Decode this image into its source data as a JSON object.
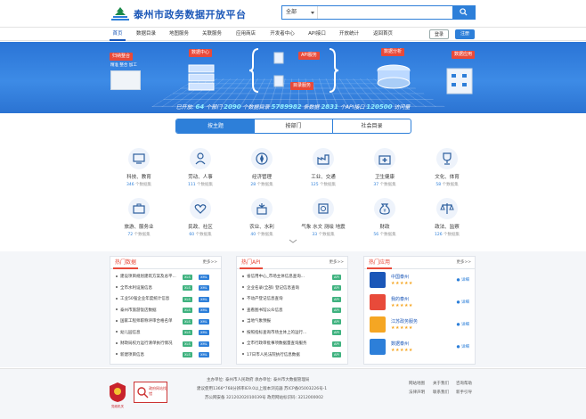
{
  "header": {
    "brand": "泰州市政务数据开放平台"
  },
  "search": {
    "scope": "全部",
    "placeholder": ""
  },
  "nav": {
    "items": [
      "首页",
      "数据目录",
      "地图服务",
      "关联服务",
      "应用商店",
      "开发者中心",
      "API接口",
      "开放统计",
      "返回首页"
    ],
    "login": "登录",
    "register": "注册"
  },
  "banner": {
    "tags": [
      "归纳整合",
      "数据中心",
      "数据分析",
      "数据应用",
      "API服务",
      "目录服务"
    ],
    "sub": "精准 整合 加工",
    "stats": {
      "prefix": "已开放:",
      "departments": "64",
      "dept_label": "个部门",
      "catalogs": "2090",
      "cat_label": "个数据目录",
      "records": "5789982",
      "rec_label": "条数据",
      "apis": "2831",
      "api_label": "个API接口",
      "visits": "120500",
      "visit_label": "访问量"
    }
  },
  "tabs": [
    "按主题",
    "按部门",
    "社会目录"
  ],
  "categories": [
    {
      "label": "科技、教育",
      "count": "346",
      "unit": "个数据集"
    },
    {
      "label": "劳动、人事",
      "count": "111",
      "unit": "个数据集"
    },
    {
      "label": "经济管理",
      "count": "28",
      "unit": "个数据集"
    },
    {
      "label": "工业、交通",
      "count": "125",
      "unit": "个数据集"
    },
    {
      "label": "卫生健康",
      "count": "37",
      "unit": "个数据集"
    },
    {
      "label": "文化、体育",
      "count": "58",
      "unit": "个数据集"
    },
    {
      "label": "旅游、服务业",
      "count": "72",
      "unit": "个数据集"
    },
    {
      "label": "民政、社区",
      "count": "60",
      "unit": "个数据集"
    },
    {
      "label": "农业、水利",
      "count": "40",
      "unit": "个数据集"
    },
    {
      "label": "气象 水文 测绘 地震",
      "count": "33",
      "unit": "个数据集"
    },
    {
      "label": "财政",
      "count": "56",
      "unit": "个数据集"
    },
    {
      "label": "政法、监察",
      "count": "126",
      "unit": "个数据集"
    }
  ],
  "hot_data": {
    "title": "热门数据",
    "more": "更多>>",
    "rows": [
      {
        "text": "建设项目规划建筑方案及总平...",
        "badges": [
          "XLS",
          "XML"
        ]
      },
      {
        "text": "全市水利设施信息",
        "badges": [
          "XLS",
          "XML"
        ]
      },
      {
        "text": "工业50强企业年度统计信息",
        "badges": [
          "XLS",
          "XML"
        ]
      },
      {
        "text": "泰州市旅游饭店数据",
        "badges": [
          "XLS",
          "XML"
        ]
      },
      {
        "text": "国家工程师职称评审合格名单",
        "badges": [
          "XLS",
          "XML"
        ]
      },
      {
        "text": "幼儿园信息",
        "badges": [
          "XLS",
          "XML"
        ]
      },
      {
        "text": "财政局权力运行清单执行情况",
        "badges": [
          "XLS",
          "XML"
        ]
      },
      {
        "text": "新建项目信息",
        "badges": [
          "XLS",
          "XML"
        ]
      }
    ]
  },
  "hot_api": {
    "title": "热门API",
    "more": "更多>>",
    "rows": [
      {
        "text": "省信用中心_市场主体信息查询...",
        "badge": "API"
      },
      {
        "text": "企业名录(全部) 登记信息查询",
        "badge": "API"
      },
      {
        "text": "不动产登记信息查询",
        "badge": "API"
      },
      {
        "text": "查看图书馆公众信息",
        "badge": "API"
      },
      {
        "text": "当地气象预报",
        "badge": "API"
      },
      {
        "text": "按照指标查询市场主体上的运行...",
        "badge": "API"
      },
      {
        "text": "全市行政审批事项数据量查询服务",
        "badge": "API"
      },
      {
        "text": "17日市人民法院执行信息数据",
        "badge": "API"
      }
    ]
  },
  "hot_apps": {
    "title": "热门应用",
    "more": "更多>>",
    "apps": [
      {
        "name": "中国泰州",
        "stars": "★★★★★",
        "action": "详细",
        "color": "#1b57b8"
      },
      {
        "name": "我的泰州",
        "stars": "★★★★★",
        "action": "详细",
        "color": "#e84a3a"
      },
      {
        "name": "江苏政务服务",
        "stars": "★★★★★",
        "action": "详细",
        "color": "#f5a623"
      },
      {
        "name": "数据泰州",
        "stars": "★★★★★",
        "action": "详细",
        "color": "#2d7fd9"
      }
    ]
  },
  "footer": {
    "line1": "主办单位: 泰州市人民政府 承办单位: 泰州市大数据管理局",
    "line2": "建议使用1366*768分辨率IE9.0以上版本浏览器  苏ICP备05003226号-1",
    "line3": "苏公网安备 32120202010039号  政府网站标识码: 3212000002",
    "links1": [
      "网站地图",
      "关于我们",
      "咨询帮助"
    ],
    "links2": [
      "法律声明",
      "联系我们",
      "新手引导"
    ],
    "emblem_text": "党政机关",
    "seal_text": "政府网站找错"
  }
}
